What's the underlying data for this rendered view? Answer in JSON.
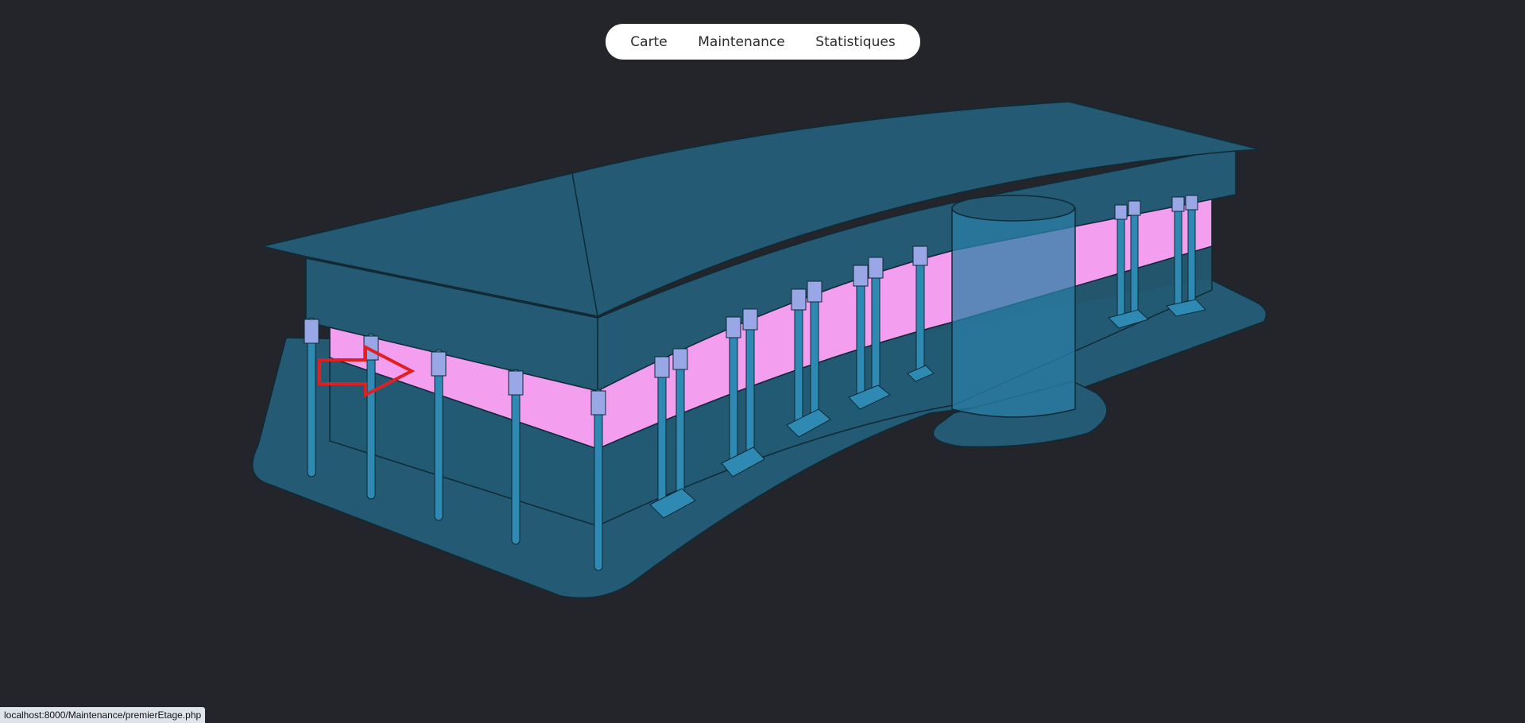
{
  "nav": {
    "items": [
      {
        "label": "Carte"
      },
      {
        "label": "Maintenance"
      },
      {
        "label": "Statistiques"
      }
    ]
  },
  "status_bar": {
    "url": "localhost:8000/Maintenance/premierEtage.php"
  },
  "colors": {
    "background": "#24252b",
    "building": "#245a73",
    "floor_highlight": "#f49ef0",
    "pillar": "#2f8ab3",
    "pillar_cap": "#9aa7e6",
    "arrow": "#e02020"
  },
  "scene": {
    "highlighted_floor": "premier étage",
    "indicator_icon": "arrow-right-icon"
  }
}
